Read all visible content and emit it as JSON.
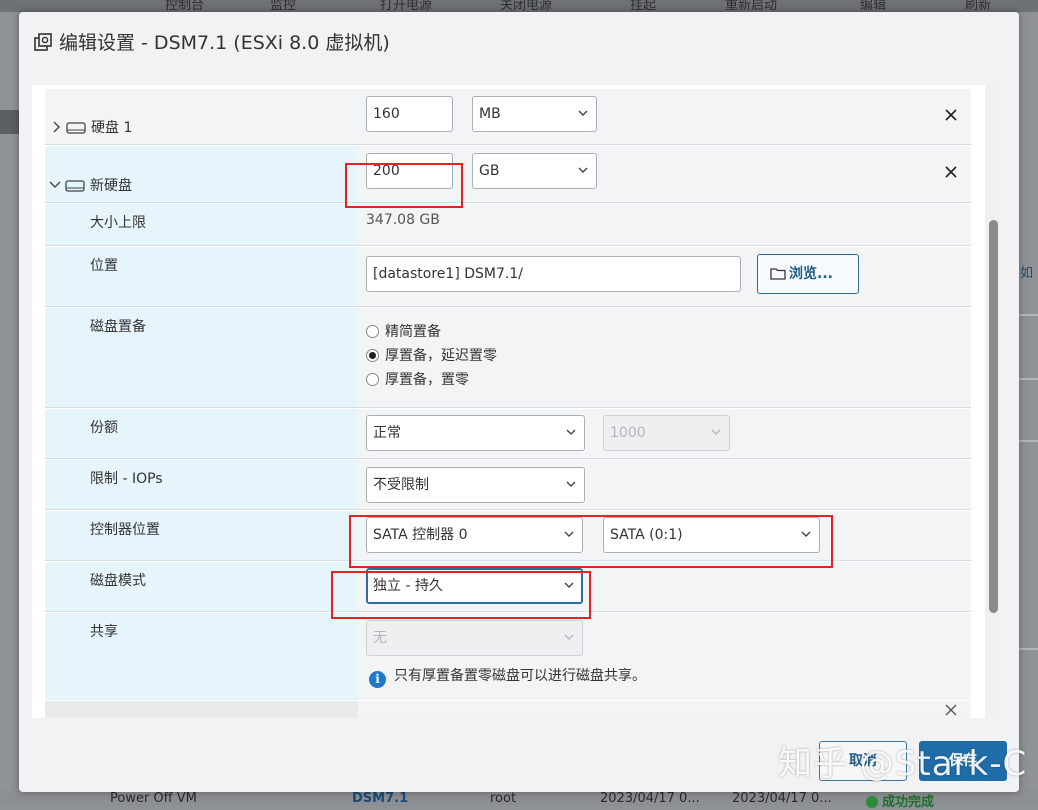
{
  "background": {
    "top_items": [
      "控制台",
      "监控",
      "打开电源",
      "关闭电源",
      "挂起",
      "重新启动",
      "编辑",
      "刷新"
    ],
    "right_fragment": "如",
    "bottom_row": {
      "task": "Power Off VM",
      "target": "DSM7.1",
      "initiator": "root",
      "queued": "2023/04/17 0...",
      "started": "2023/04/17 0...",
      "result": "成功完成"
    }
  },
  "dialog": {
    "title": "编辑设置 - DSM7.1 (ESXi 8.0 虚拟机)",
    "disk1": {
      "label": "硬盘 1",
      "size_value": "160",
      "size_unit": "MB"
    },
    "new_disk": {
      "label": "新硬盘",
      "size_value": "200",
      "size_unit": "GB",
      "max_size_label": "大小上限",
      "max_size_value": "347.08 GB",
      "location_label": "位置",
      "location_value": "[datastore1] DSM7.1/",
      "browse_label": "浏览...",
      "provision_label": "磁盘置备",
      "provision_options": [
        "精简置备",
        "厚置备，延迟置零",
        "厚置备，置零"
      ],
      "provision_selected": 1,
      "shares_label": "份额",
      "shares_value": "正常",
      "shares_number": "1000",
      "iops_label": "限制 - IOPs",
      "iops_value": "不受限制",
      "controller_label": "控制器位置",
      "controller_value": "SATA 控制器 0",
      "controller_port": "SATA (0:1)",
      "mode_label": "磁盘模式",
      "mode_value": "独立 - 持久",
      "sharing_label": "共享",
      "sharing_value": "无",
      "sharing_info": "只有厚置备置零磁盘可以进行磁盘共享。"
    },
    "buttons": {
      "cancel": "取消",
      "save": "保存"
    }
  },
  "watermark": "知乎 @Stark-C",
  "colors": {
    "accent": "#1e6da8",
    "label_bg": "#e6f4fb",
    "highlight": "#e02424"
  }
}
